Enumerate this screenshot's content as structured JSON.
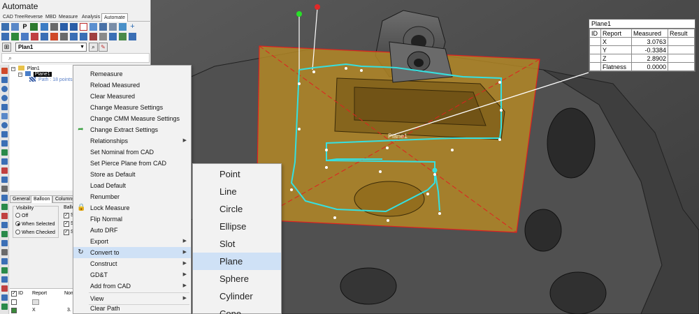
{
  "app": {
    "title": "Automate"
  },
  "tabs": [
    "CAD Tree",
    "Reverse",
    "MBD",
    "Measure",
    "Analysis",
    "Automate"
  ],
  "feature_selector": {
    "value": "Plan1"
  },
  "tree": {
    "root": "Plan1",
    "child": "Plane1",
    "path_label": "Path : 18 points"
  },
  "props_tabs": [
    "General",
    "Balloon",
    "Columns"
  ],
  "visibility": {
    "title": "Visibility",
    "options": [
      "Off",
      "When Selected",
      "When Checked"
    ],
    "selected": 1
  },
  "ball_group": {
    "title": "Ballo",
    "items": [
      "S",
      "S",
      "S"
    ]
  },
  "grid": {
    "headers": [
      "ID",
      "Report",
      "Nom"
    ],
    "row_value": "X",
    "row_nominal": "3."
  },
  "context_menu": {
    "items": [
      {
        "label": "Remeasure",
        "submenu": false
      },
      {
        "label": "Reload Measured",
        "submenu": false
      },
      {
        "label": "Clear Measured",
        "submenu": false
      },
      {
        "label": "Change Measure Settings",
        "submenu": false
      },
      {
        "label": "Change CMM Measure Settings",
        "submenu": false
      },
      {
        "label": "Change Extract Settings",
        "submenu": false,
        "icon": "green-arrow-icon"
      },
      {
        "label": "Relationships",
        "submenu": true
      },
      {
        "label": "Set Nominal from CAD",
        "submenu": false
      },
      {
        "label": "Set Pierce Plane from CAD",
        "submenu": false
      },
      {
        "label": "Store as Default",
        "submenu": false
      },
      {
        "label": "Load Default",
        "submenu": false
      },
      {
        "label": "Renumber",
        "submenu": false
      },
      {
        "label": "Lock Measure",
        "submenu": false,
        "icon": "lock-icon"
      },
      {
        "label": "Flip Normal",
        "submenu": false
      },
      {
        "label": "Auto DRF",
        "submenu": false
      },
      {
        "label": "Export",
        "submenu": true
      },
      {
        "label": "Convert to",
        "submenu": true,
        "highlighted": true,
        "icon": "convert-icon"
      },
      {
        "label": "Construct",
        "submenu": true
      },
      {
        "label": "GD&T",
        "submenu": true
      },
      {
        "label": "Add from CAD",
        "submenu": true
      },
      {
        "label": "View",
        "submenu": true
      },
      {
        "label": "Clear Path",
        "submenu": false
      }
    ]
  },
  "convert_submenu": {
    "items": [
      "Point",
      "Line",
      "Circle",
      "Ellipse",
      "Slot",
      "Plane",
      "Sphere",
      "Cylinder",
      "Cone"
    ],
    "highlighted": "Plane"
  },
  "result_table": {
    "title": "Plane1",
    "headers": [
      "ID",
      "Report",
      "Measured",
      "Result"
    ],
    "rows": [
      {
        "report": "X",
        "measured": "3.0763"
      },
      {
        "report": "Y",
        "measured": "-0.3384"
      },
      {
        "report": "Z",
        "measured": "2.8902"
      },
      {
        "report": "Flatness",
        "measured": "0.0000"
      }
    ]
  },
  "viewport": {
    "plane_label": "Plane1"
  },
  "colors": {
    "plane_fill": "#b78a24",
    "plane_edge": "#e02020",
    "path": "#36e0e0",
    "menu_highlight": "#cfe1f6"
  }
}
